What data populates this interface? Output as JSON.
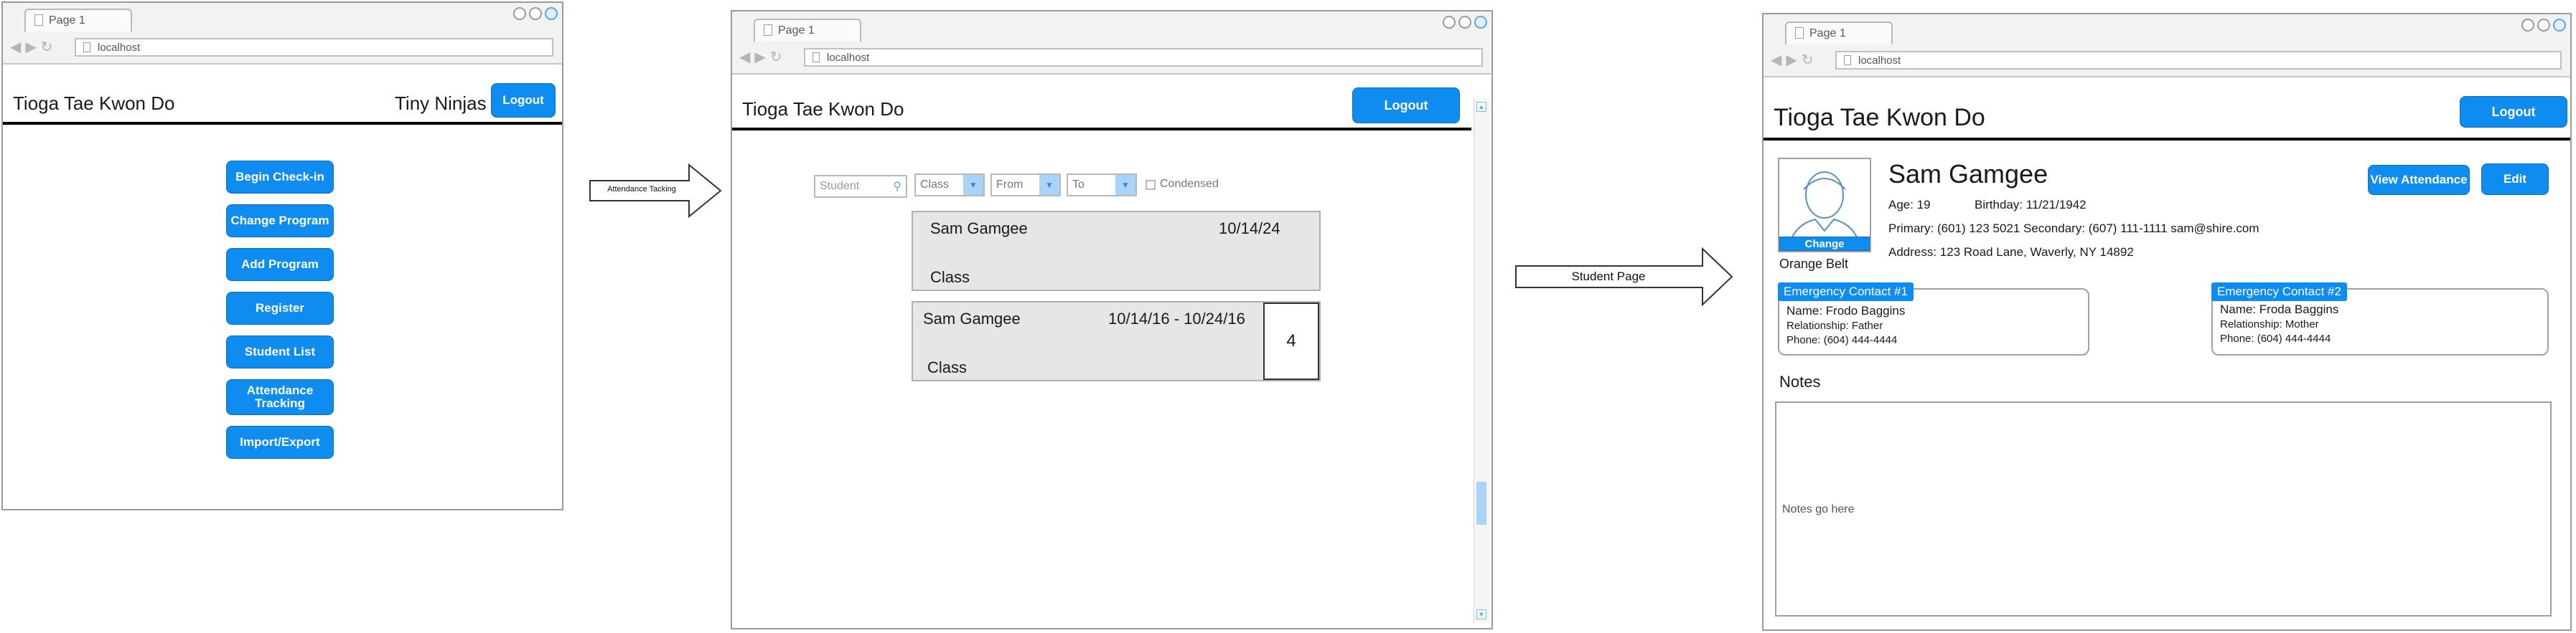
{
  "browser": {
    "tab_label": "Page 1",
    "address": "localhost"
  },
  "screen1": {
    "brand": "Tioga Tae Kwon Do",
    "class_name": "Tiny Ninjas",
    "logout": "Logout",
    "menu": [
      "Begin Check-in",
      "Change Program",
      "Add Program",
      "Register",
      "Student List",
      "Attendance Tracking",
      "Import/Export"
    ]
  },
  "arrow1_label": "Attendance Tacking",
  "screen2": {
    "brand": "Tioga Tae Kwon Do",
    "logout": "Logout",
    "filters": {
      "student_placeholder": "Student",
      "class_value": "Class",
      "from_value": "From",
      "to_value": "To",
      "condensed_label": "Condensed"
    },
    "cards": [
      {
        "name": "Sam Gamgee",
        "date": "10/14/24",
        "class": "Class"
      },
      {
        "name": "Sam Gamgee",
        "date": "10/14/16 - 10/24/16",
        "class": "Class",
        "count": "4"
      }
    ]
  },
  "arrow2_label": "Student Page",
  "screen3": {
    "brand": "Tioga Tae Kwon Do",
    "logout": "Logout",
    "student": {
      "name": "Sam Gamgee",
      "age": "Age: 19",
      "birthday": "Birthday: 11/21/1942",
      "phones": "Primary: (601) 123 5021 Secondary: (607) 111-1111  sam@shire.com",
      "address": "Address: 123 Road Lane, Waverly, NY 14892",
      "belt": "Orange Belt",
      "change": "Change"
    },
    "view_attendance": "View Attendance",
    "edit": "Edit",
    "contacts": [
      {
        "title": "Emergency Contact #1",
        "name": "Name: Frodo Baggins",
        "relationship": "Relationship: Father",
        "phone": "Phone: (604) 444-4444"
      },
      {
        "title": "Emergency Contact #2",
        "name": "Name: Froda Baggins",
        "relationship": "Relationship: Mother",
        "phone": "Phone: (604) 444-4444"
      }
    ],
    "notes_heading": "Notes",
    "notes_text": "Notes go here"
  },
  "colors": {
    "accent": "#0f8cf0",
    "card_bg": "#e6e6e6",
    "frame": "#9a9a9a"
  }
}
